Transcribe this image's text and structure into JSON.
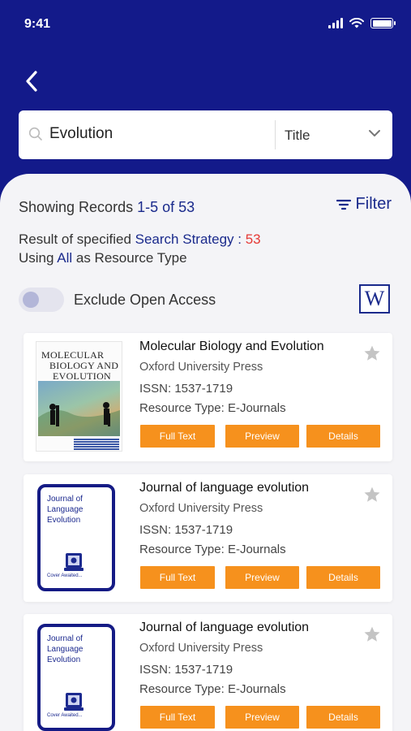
{
  "status_bar": {
    "time": "9:41"
  },
  "search": {
    "query": "Evolution",
    "field": "Title"
  },
  "results": {
    "prefix": "Showing Records ",
    "range": "1-5 of 53",
    "filter_label": "Filter",
    "strategy_prefix": "Result of specified ",
    "strategy_link": "Search Strategy",
    "strategy_colon": " : ",
    "strategy_count": "53",
    "using_prefix": "Using ",
    "using_value": "All",
    "using_suffix": " as Resource Type"
  },
  "toggle": {
    "label": "Exclude Open Access",
    "on": false
  },
  "cards": [
    {
      "title": "Molecular Biology and Evolution",
      "publisher": "Oxford University Press",
      "issn": "ISSN: 1537-1719",
      "resource_type": "Resource Type: E-Journals",
      "cover_title_1": "MOLECULAR",
      "cover_title_2": "BIOLOGY AND",
      "cover_title_3": "EVOLUTION",
      "buttons": [
        "Full Text",
        "Preview",
        "Details"
      ]
    },
    {
      "title": "Journal of language evolution",
      "publisher": "Oxford University Press",
      "issn": "ISSN: 1537-1719",
      "resource_type": "Resource Type: E-Journals",
      "cover_title": "Journal of Language Evolution",
      "cover_foot": "Cover Awaited...",
      "buttons": [
        "Full Text",
        "Preview",
        "Details"
      ]
    },
    {
      "title": "Journal of language evolution",
      "publisher": "Oxford University Press",
      "issn": "ISSN: 1537-1719",
      "resource_type": "Resource Type: E-Journals",
      "cover_title": "Journal of Language Evolution",
      "cover_foot": "Cover Awaited...",
      "buttons": [
        "Full Text",
        "Preview",
        "Details"
      ]
    }
  ],
  "icons": {
    "back": "chevron-left-icon",
    "search": "search-icon",
    "dropdown": "chevron-down-icon",
    "filter": "filter-icon",
    "wikipedia": "wikipedia-icon",
    "favorite": "star-icon"
  },
  "colors": {
    "header": "#131a8a",
    "accent": "#1a2a8c",
    "button": "#f6911d",
    "count": "#e53935",
    "star": "#c4c4c4"
  }
}
